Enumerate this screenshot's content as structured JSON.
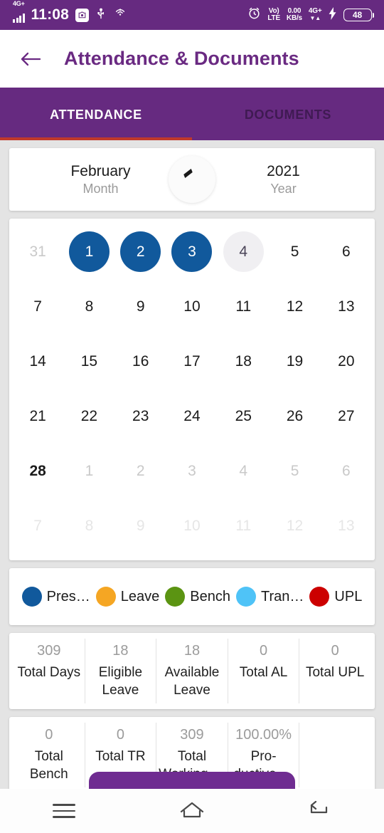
{
  "statusbar": {
    "network_badge": "4G+",
    "time": "11:08",
    "chip_icon": "screenshot-icon",
    "usb_icon": "usb-icon",
    "cast_icon": "cast-icon",
    "alarm_icon": "alarm-icon",
    "volte_line1": "Vo)",
    "volte_line2": "LTE",
    "data_rate_value": "0.00",
    "data_rate_unit": "KB/s",
    "data_network": "4G+",
    "charging_icon": "bolt-icon",
    "battery_level": "48"
  },
  "appbar": {
    "back_icon": "arrow-left-icon",
    "title": "Attendance & Documents",
    "accent": "#6a2a82"
  },
  "tabs": {
    "items": [
      {
        "label": "ATTENDANCE",
        "active": true
      },
      {
        "label": "DOCUMENTS",
        "active": false
      }
    ],
    "indicator_color": "#c0392b",
    "bar_color": "#662a80"
  },
  "period": {
    "month_value": "February",
    "month_label": "Month",
    "year_value": "2021",
    "year_label": "Year",
    "sync_icon": "sync-icon"
  },
  "calendar": {
    "weeks": [
      [
        {
          "day": "31",
          "state": "muted"
        },
        {
          "day": "1",
          "state": "present"
        },
        {
          "day": "2",
          "state": "present"
        },
        {
          "day": "3",
          "state": "present"
        },
        {
          "day": "4",
          "state": "today"
        },
        {
          "day": "5",
          "state": "normal"
        },
        {
          "day": "6",
          "state": "normal"
        }
      ],
      [
        {
          "day": "7",
          "state": "normal"
        },
        {
          "day": "8",
          "state": "normal"
        },
        {
          "day": "9",
          "state": "normal"
        },
        {
          "day": "10",
          "state": "normal"
        },
        {
          "day": "11",
          "state": "normal"
        },
        {
          "day": "12",
          "state": "normal"
        },
        {
          "day": "13",
          "state": "normal"
        }
      ],
      [
        {
          "day": "14",
          "state": "normal"
        },
        {
          "day": "15",
          "state": "normal"
        },
        {
          "day": "16",
          "state": "normal"
        },
        {
          "day": "17",
          "state": "normal"
        },
        {
          "day": "18",
          "state": "normal"
        },
        {
          "day": "19",
          "state": "normal"
        },
        {
          "day": "20",
          "state": "normal"
        }
      ],
      [
        {
          "day": "21",
          "state": "normal"
        },
        {
          "day": "22",
          "state": "normal"
        },
        {
          "day": "23",
          "state": "normal"
        },
        {
          "day": "24",
          "state": "normal"
        },
        {
          "day": "25",
          "state": "normal"
        },
        {
          "day": "26",
          "state": "normal"
        },
        {
          "day": "27",
          "state": "normal"
        }
      ],
      [
        {
          "day": "28",
          "state": "bold"
        },
        {
          "day": "1",
          "state": "muted"
        },
        {
          "day": "2",
          "state": "muted"
        },
        {
          "day": "3",
          "state": "muted"
        },
        {
          "day": "4",
          "state": "muted"
        },
        {
          "day": "5",
          "state": "muted"
        },
        {
          "day": "6",
          "state": "muted"
        }
      ],
      [
        {
          "day": "7",
          "state": "faint"
        },
        {
          "day": "8",
          "state": "faint"
        },
        {
          "day": "9",
          "state": "faint"
        },
        {
          "day": "10",
          "state": "faint"
        },
        {
          "day": "11",
          "state": "faint"
        },
        {
          "day": "12",
          "state": "faint"
        },
        {
          "day": "13",
          "state": "faint"
        }
      ]
    ]
  },
  "legend": [
    {
      "label": "Pres…",
      "color": "#11599c"
    },
    {
      "label": "Leave",
      "color": "#f5a623"
    },
    {
      "label": "Bench",
      "color": "#5b9412"
    },
    {
      "label": "Tran…",
      "color": "#4fc3f7"
    },
    {
      "label": "UPL",
      "color": "#cc0000"
    }
  ],
  "stats": {
    "row1": [
      {
        "value": "309",
        "label": "Total Days"
      },
      {
        "value": "18",
        "label": "Eligible Leave"
      },
      {
        "value": "18",
        "label": "Available Leave"
      },
      {
        "value": "0",
        "label": "Total AL"
      },
      {
        "value": "0",
        "label": "Total UPL"
      }
    ],
    "row2": [
      {
        "value": "0",
        "label": "Total Bench"
      },
      {
        "value": "0",
        "label": "Total TR"
      },
      {
        "value": "309",
        "label": "Total Working …"
      },
      {
        "value": "100.00%",
        "label": "Pro-ductive …"
      },
      {
        "value": "",
        "label": ""
      }
    ]
  },
  "bottom_action": {
    "color": "#6f2c91"
  },
  "navbar": {
    "menu_icon": "menu-icon",
    "home_icon": "home-icon",
    "back_icon": "back-icon"
  }
}
